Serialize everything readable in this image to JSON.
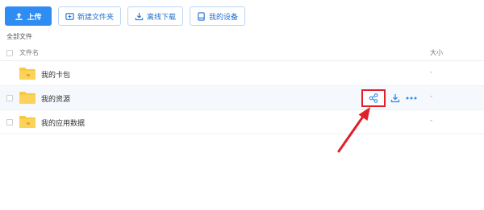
{
  "toolbar": {
    "upload_label": "上传",
    "new_folder_label": "新建文件夹",
    "offline_download_label": "离线下载",
    "my_devices_label": "我的设备"
  },
  "breadcrumb": "全部文件",
  "columns": {
    "name": "文件名",
    "size": "大小"
  },
  "files": [
    {
      "name": "我的卡包",
      "size": "-",
      "icon": "folder-icon"
    },
    {
      "name": "我的资源",
      "size": "-",
      "icon": "folder-icon"
    },
    {
      "name": "我的应用数据",
      "size": "-",
      "icon": "folder-icon"
    }
  ],
  "row_actions": [
    "share-icon",
    "download-icon",
    "more-icon"
  ],
  "colors": {
    "primary": "#2f8cf2",
    "folder": "#f7c844",
    "highlight": "#e0202a"
  }
}
